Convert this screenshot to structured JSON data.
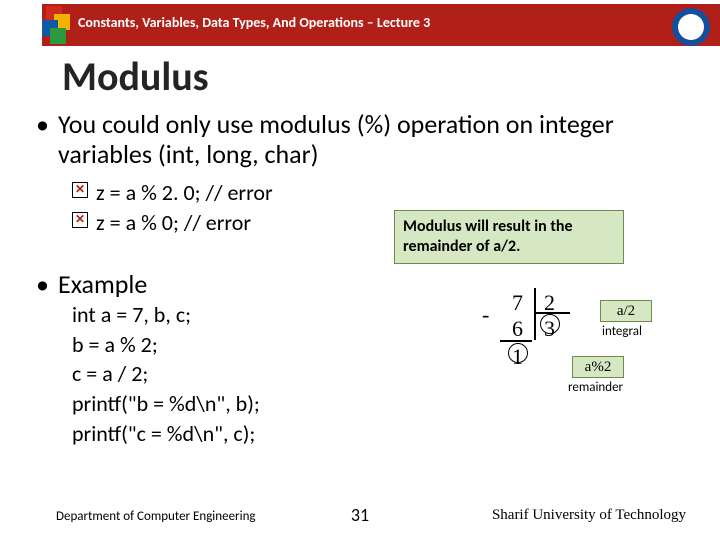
{
  "header": {
    "breadcrumb": "Constants, Variables, Data Types, And Operations – Lecture 3",
    "logo_left_name": "puzzle-logo",
    "badge_right_name": "university-seal"
  },
  "title": "Modulus",
  "body": {
    "point1": "You could only use modulus (%) operation on integer variables (int, long, char)",
    "errors": [
      "z = a  %  2. 0; // error",
      "z = a  %  0; // error"
    ],
    "callout": "Modulus will result in the remainder of a/2."
  },
  "example": {
    "heading": "Example",
    "lines": [
      "int a = 7, b, c;",
      "b = a % 2;",
      "c = a / 2;",
      "printf(\"b = %d\\n\", b);",
      "printf(\"c = %d\\n\", c);"
    ]
  },
  "figure": {
    "dividend": "7",
    "divisor": "2",
    "sub": "6",
    "quotient": "3",
    "remainder": "1",
    "minus": "-",
    "box_quotient": "a/2",
    "box_remainder": "a%2",
    "label_quotient": "integral",
    "label_remainder": "remainder"
  },
  "footer": {
    "left": "Department of Computer Engineering",
    "page": "31",
    "right": "Sharif University of Technology"
  },
  "glyphs": {
    "bullet": "•",
    "xmark": "✕"
  }
}
